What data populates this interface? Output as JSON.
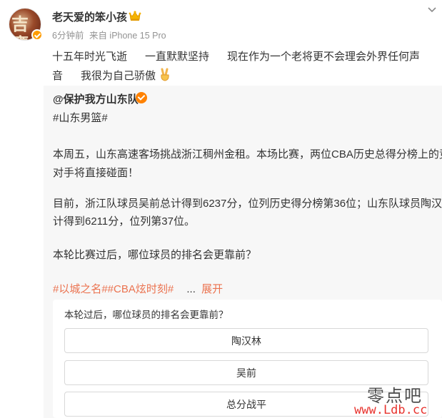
{
  "post": {
    "username": "老天爱的笨小孩",
    "time": "6分钟前",
    "source": "来自 iPhone 15 Pro",
    "text_line1": "十五年时光飞逝      一直默默坚持      现在作为一个老将更不会理会外界任何声",
    "text_line2": "音      我很为自己骄傲",
    "avatar_glyph": "吉鹰",
    "icons": {
      "crown": "crown-icon",
      "chevron": "chevron-down-icon",
      "emoji": "victory-hand-emoji"
    }
  },
  "repost": {
    "author": "@保护我方山东队",
    "topic": "#山东男篮#",
    "para1_line1": "本周五，山东高速客场挑战浙江稠州金租。本场比赛，两位CBA历史总得分榜上的竞争",
    "para1_line2": "对手将直接碰面！",
    "para2_line1": "目前，浙江队球员吴前总计得到6237分，位列历史得分榜第36位；山东队球员陶汉林总",
    "para2_line2": "计得到6211分，位列第37位。",
    "para3": "本轮比赛过后，哪位球员的排名会更靠前？",
    "tags": "#以城之名##CBA炫时刻#",
    "ellipsis": "...",
    "expand": "展开"
  },
  "poll": {
    "question": "本轮过后，哪位球员的排名会更靠前？",
    "options": [
      "陶汉林",
      "吴前",
      "总分战平"
    ]
  },
  "watermark": {
    "site_name": "零点吧",
    "url": "www.Ldb.cc"
  },
  "colors": {
    "accent": "#eb7350",
    "verified": "#ff8200",
    "meta": "#939393",
    "repost_bg": "#f7f7f7"
  }
}
